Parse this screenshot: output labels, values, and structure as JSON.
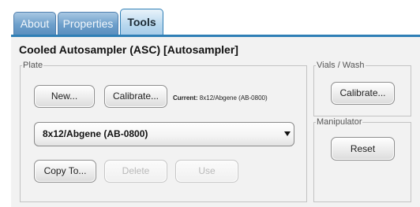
{
  "tabs": [
    {
      "label": "About"
    },
    {
      "label": "Properties"
    },
    {
      "label": "Tools",
      "selected": true
    }
  ],
  "title": "Cooled Autosampler (ASC) [Autosampler]",
  "plate": {
    "legend": "Plate",
    "new_label": "New...",
    "calibrate_label": "Calibrate...",
    "current_prefix": "Current:",
    "current_value": "8x12/Abgene (AB-0800)",
    "selected_plate": "8x12/Abgene (AB-0800)",
    "copy_label": "Copy To...",
    "delete_label": "Delete",
    "use_label": "Use"
  },
  "vials": {
    "legend": "Vials / Wash",
    "calibrate_label": "Calibrate..."
  },
  "manipulator": {
    "legend": "Manipulator",
    "reset_label": "Reset"
  },
  "colors": {
    "tab_active": "#b7d7ee",
    "tab_inactive": "#6d9fcb",
    "tab_line": "#2f7fb6",
    "panel": "#f2f2f2"
  }
}
